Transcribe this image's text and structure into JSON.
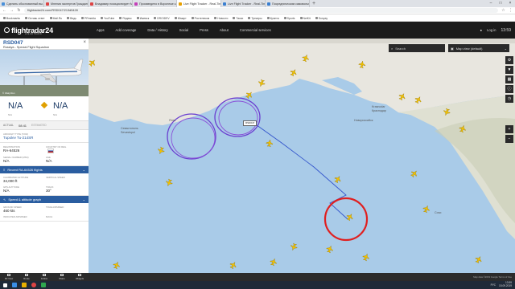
{
  "browser": {
    "tabs": [
      {
        "label": "Сделать обоснованный вы...",
        "color": "#4a90d9",
        "active": false
      },
      {
        "label": "Мнения экспертов Гражданской...",
        "color": "#d44",
        "active": false
      },
      {
        "label": "Владимир позиционирует Москвой...",
        "color": "#d44",
        "active": false
      },
      {
        "label": "Произведено в Воронеже к...",
        "color": "#c43fb8",
        "active": false
      },
      {
        "label": "Live Flight Tracker - Real-Time...",
        "color": "#e8a000",
        "active": true
      },
      {
        "label": "Live Flight Tracker - Real-Time Fl...",
        "color": "#3a7fd0",
        "active": false
      },
      {
        "label": "Посредническим самовольна...",
        "color": "#3a7fd0",
        "active": false
      }
    ],
    "url": "flightradar24.com/RSD047/213d5428",
    "bookmarks": [
      "Bookmarks",
      "Оставь ответ",
      "Mail.Ru",
      "Ведь",
      "PRmedia",
      "YouTube",
      "Яндекс",
      "Ижевск",
      "DROIDEV",
      "Юмарт",
      "Ростелеком",
      "Новости",
      "Такси",
      "Трекеры",
      "Крипта",
      "Sports",
      "NetKit",
      "Sonyay"
    ]
  },
  "header": {
    "logo": "flightradar24",
    "logo_sub": "LIVE AIR TRAFFIC",
    "menu": [
      "Apps",
      "Add coverage",
      "Data / History",
      "Social",
      "Press",
      "About",
      "Commercial services"
    ],
    "login": "Log in",
    "clock": "13:59"
  },
  "flight": {
    "callsign": "RSD047",
    "airline": "Rossiya - Special Flight Squadron",
    "photo_credit": "© Vitaly Ren",
    "origin": "N/A",
    "destination": "N/A",
    "origin_sub": "N/A",
    "destination_sub": "N/A",
    "actual_label": "ACTUAL",
    "actual_time": "08:41",
    "estimated_label": "ESTIMATED",
    "aircraft_type_label": "AIRCRAFT TYPE (T204)",
    "aircraft_type": "Tupolev Tu-214SR",
    "registration_label": "REGISTRATION",
    "registration": "RA-64526",
    "country_label": "COUNTRY OF REG.",
    "serial_label": "SERIAL NUMBER (MSN)",
    "serial": "N/A",
    "age_label": "AGE",
    "age": "N/A",
    "recent_flights": "Recent RA-64526 flights",
    "calibrated_alt_label": "CALIBRATED ALTITUDE",
    "calibrated_alt": "34,000 ft",
    "vertical_speed_label": "VERTICAL SPEED",
    "gps_alt_label": "GPS ALTITUDE",
    "gps_alt": "N/A",
    "track_label": "TRACK",
    "track": "30°",
    "speed_section": "Speed & altitude graph",
    "ground_speed_label": "GROUND SPEED",
    "ground_speed": "460 kts",
    "true_airspeed_label": "TRUE AIRSPEED",
    "indicated_airspeed_label": "INDICATED AIRSPEED",
    "mach_label": "MACH"
  },
  "map": {
    "search_placeholder": "Search",
    "map_view": "Map view (default)",
    "flight_tag": "RSD047",
    "labels": [
      {
        "text": "Севастополь",
        "kind": "city"
      },
      {
        "text": "Sevastopol",
        "kind": "city"
      },
      {
        "text": "Krasnodar",
        "kind": "city"
      },
      {
        "text": "Краснодар",
        "kind": "city"
      },
      {
        "text": "Ялта",
        "kind": "city"
      },
      {
        "text": "Сочи",
        "kind": "city"
      },
      {
        "text": "Новороссийск",
        "kind": "city"
      }
    ],
    "side_buttons": [
      "+",
      "−"
    ],
    "attribution": "Map data ©2019 Google Terms of Use"
  },
  "toolbar": {
    "buttons": [
      "3D View",
      "Route",
      "Follow",
      "Share",
      "Widgets"
    ]
  },
  "taskbar": {
    "lang": "РУС",
    "time": "13:59",
    "date": "15.09.2019"
  },
  "colors": {
    "header_bg": "#1b1b1b",
    "accent": "#2a5da0",
    "track_line": "#3355cc",
    "orbit_purple": "#7a3fd0",
    "circle_red": "#e02020",
    "sea": "#a9cbe8",
    "land": "#e8e6df",
    "plane_yellow": "#f2c200"
  }
}
